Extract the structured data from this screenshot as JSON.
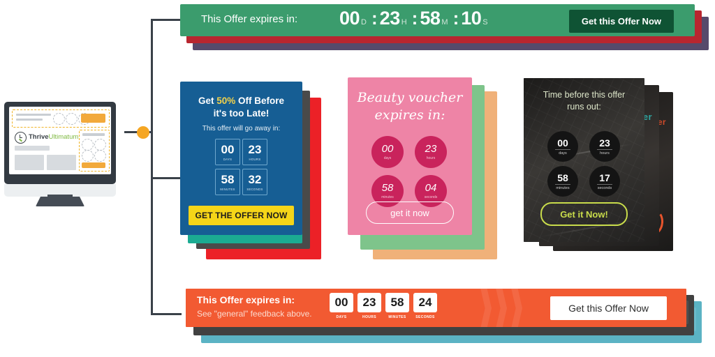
{
  "page": {
    "background": "#ffffff",
    "accent_orange": "#f5a623"
  },
  "monitor": {
    "brand_name": "Thrive",
    "brand_suffix": "Ultimatum",
    "logo_icon": "clock-checkmark-icon"
  },
  "top_bar": {
    "label": "This Offer expires in:",
    "cta": "Get this Offer Now",
    "background": "#3b9c6d",
    "cta_background": "#0f5334",
    "timer": [
      {
        "value": "00",
        "unit": "D"
      },
      {
        "value": "23",
        "unit": "H"
      },
      {
        "value": "58",
        "unit": "M"
      },
      {
        "value": "10",
        "unit": "S"
      }
    ],
    "separator": ":",
    "stack_layers": [
      "#3b9c6d",
      "#b8262f",
      "#564a6b"
    ]
  },
  "blue_card": {
    "headline_pre": "Get ",
    "headline_highlight": "50%",
    "headline_post": " Off Before",
    "headline_line2": "it's too Late!",
    "subtitle": "This offer will go away in:",
    "cta": "GET THE OFFER NOW",
    "background": "#165e94",
    "cta_background": "#f5d518",
    "timer": [
      {
        "value": "00",
        "unit": "DAYS"
      },
      {
        "value": "23",
        "unit": "HOURS"
      },
      {
        "value": "58",
        "unit": "MINUTES"
      },
      {
        "value": "32",
        "unit": "SECONDS"
      }
    ],
    "stack_layers": [
      "#165e94",
      "#1bab92",
      "#4a4a4a",
      "#ec2127"
    ]
  },
  "pink_card": {
    "headline_line1": "Beauty voucher",
    "headline_line2": "expires in:",
    "cta": "get it now",
    "background": "#ee84a6",
    "bubble_color": "#c9235c",
    "timer": [
      {
        "value": "00",
        "unit": "days"
      },
      {
        "value": "23",
        "unit": "hours"
      },
      {
        "value": "58",
        "unit": "minutes"
      },
      {
        "value": "04",
        "unit": "seconds"
      }
    ],
    "stack_layers": [
      "#ee84a6",
      "#7ec48b",
      "#f0b179"
    ]
  },
  "dark_card": {
    "headline_line1": "Time before this offer",
    "headline_line2": "runs out:",
    "cta": "Get it Now!",
    "background": "#2a2927",
    "cta_border": "#c9dc4b",
    "timer": [
      {
        "value": "00",
        "unit": "days"
      },
      {
        "value": "23",
        "unit": "hours"
      },
      {
        "value": "58",
        "unit": "minutes"
      },
      {
        "value": "17",
        "unit": "seconds"
      }
    ],
    "ghost_labels": [
      "er",
      "er"
    ],
    "stack_layers": [
      "#2a2927",
      "#201f1e",
      "#171615"
    ]
  },
  "bottom_bar": {
    "label": "This Offer expires in:",
    "subtitle": "See \"general\" feedback above.",
    "cta": "Get this Offer Now",
    "background": "#f25a32",
    "timer": [
      {
        "value": "00",
        "unit": "DAYS"
      },
      {
        "value": "23",
        "unit": "HOURS"
      },
      {
        "value": "58",
        "unit": "MINUTES"
      },
      {
        "value": "24",
        "unit": "SECONDS"
      }
    ],
    "ghost_units_row1": [
      "DAYS",
      "HOURS",
      "MINUTES",
      "SECONDS"
    ],
    "ghost_units_row2": [
      "DAYS",
      "HOURS",
      "MINUTES",
      "SECONDS"
    ],
    "stack_layers": [
      "#f25a32",
      "#414141",
      "#5bb3c4"
    ]
  }
}
